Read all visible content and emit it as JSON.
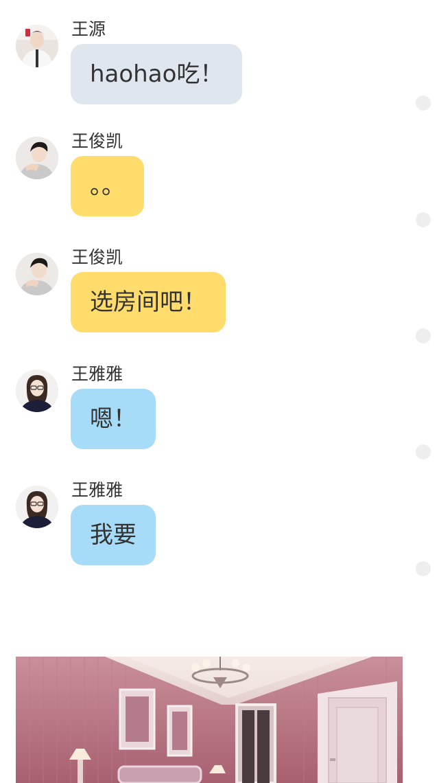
{
  "messages": [
    {
      "sender": "王源",
      "text": "haohao吃！",
      "bubble_color": "#dfe6ee",
      "avatar": "avatar-wang-yuan"
    },
    {
      "sender": "王俊凯",
      "text": "。。",
      "bubble_color": "#ffdc6b",
      "avatar": "avatar-wang-junkai"
    },
    {
      "sender": "王俊凯",
      "text": "选房间吧！",
      "bubble_color": "#ffdc6b",
      "avatar": "avatar-wang-junkai"
    },
    {
      "sender": "王雅雅",
      "text": "嗯！",
      "bubble_color": "#a6dcf8",
      "avatar": "avatar-wang-yaya"
    },
    {
      "sender": "王雅雅",
      "text": "我要",
      "bubble_color": "#a6dcf8",
      "avatar": "avatar-wang-yaya"
    }
  ],
  "photo": {
    "subject": "pink-bedroom-photo"
  }
}
